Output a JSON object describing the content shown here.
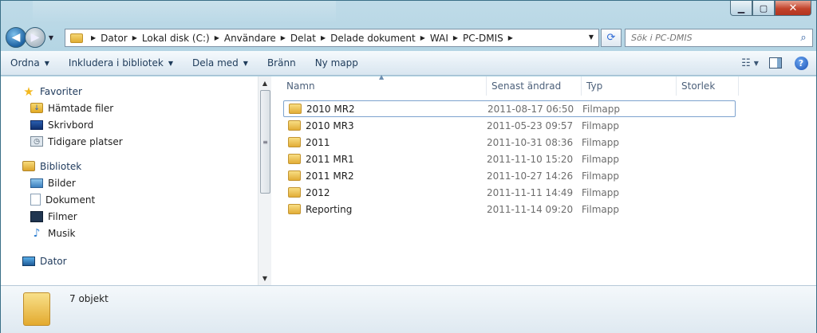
{
  "window": {
    "controls": {
      "minimize": "▁",
      "maximize": "▢",
      "close": "✕"
    }
  },
  "navigation": {
    "back_glyph": "◀",
    "forward_glyph": "▶",
    "breadcrumbs": [
      "Dator",
      "Lokal disk (C:)",
      "Användare",
      "Delat",
      "Delade dokument",
      "WAI",
      "PC-DMIS"
    ],
    "refresh_glyph": "⟳"
  },
  "search": {
    "placeholder": "Sök i PC-DMIS",
    "icon": "magnifier-icon"
  },
  "toolbar": {
    "items": [
      {
        "label": "Ordna",
        "dropdown": true
      },
      {
        "label": "Inkludera i bibliotek",
        "dropdown": true
      },
      {
        "label": "Dela med",
        "dropdown": true
      },
      {
        "label": "Bränn",
        "dropdown": false
      },
      {
        "label": "Ny mapp",
        "dropdown": false
      }
    ],
    "help_label": "?"
  },
  "sidebar": {
    "favorites": {
      "label": "Favoriter",
      "items": [
        "Hämtade filer",
        "Skrivbord",
        "Tidigare platser"
      ]
    },
    "libraries": {
      "label": "Bibliotek",
      "items": [
        "Bilder",
        "Dokument",
        "Filmer",
        "Musik"
      ]
    },
    "computer": {
      "label": "Dator"
    }
  },
  "file_list": {
    "columns": [
      "Namn",
      "Senast ändrad",
      "Typ",
      "Storlek"
    ],
    "rows": [
      {
        "name": "2010 MR2",
        "modified": "2011-08-17 06:50",
        "type": "Filmapp",
        "selected": true
      },
      {
        "name": "2010 MR3",
        "modified": "2011-05-23 09:57",
        "type": "Filmapp"
      },
      {
        "name": "2011",
        "modified": "2011-10-31 08:36",
        "type": "Filmapp"
      },
      {
        "name": "2011 MR1",
        "modified": "2011-11-10 15:20",
        "type": "Filmapp"
      },
      {
        "name": "2011 MR2",
        "modified": "2011-10-27 14:26",
        "type": "Filmapp"
      },
      {
        "name": "2012",
        "modified": "2011-11-11 14:49",
        "type": "Filmapp"
      },
      {
        "name": "Reporting",
        "modified": "2011-11-14 09:20",
        "type": "Filmapp"
      }
    ]
  },
  "status": {
    "count_text": "7 objekt"
  },
  "colors": {
    "accent": "#1e395b",
    "selection_border": "#7da2ce",
    "title_bar": "#a9cfe0"
  }
}
